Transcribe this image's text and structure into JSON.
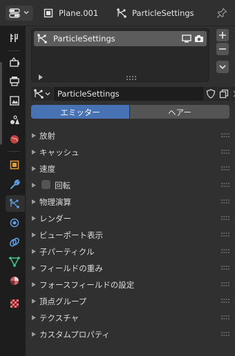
{
  "header": {
    "object_name": "Plane.001",
    "particle_settings_name": "ParticleSettings"
  },
  "list": {
    "items": [
      {
        "label": "ParticleSettings"
      }
    ]
  },
  "datablock": {
    "name": "ParticleSettings"
  },
  "type_toggle": {
    "emitter_label": "エミッター",
    "hair_label": "ヘアー",
    "selected": "エミッター"
  },
  "panels": [
    {
      "label": "放射"
    },
    {
      "label": "キャッシュ"
    },
    {
      "label": "速度"
    },
    {
      "label": "回転",
      "checkbox": false
    },
    {
      "label": "物理演算"
    },
    {
      "label": "レンダー"
    },
    {
      "label": "ビューポート表示"
    },
    {
      "label": "子パーティクル"
    },
    {
      "label": "フィールドの重み"
    },
    {
      "label": "フォースフィールドの設定"
    },
    {
      "label": "頂点グループ"
    },
    {
      "label": "テクスチャ"
    },
    {
      "label": "カスタムプロパティ"
    }
  ],
  "property_tabs": [
    {
      "icon": "tool-icon"
    },
    {
      "icon": "render-icon"
    },
    {
      "icon": "output-icon"
    },
    {
      "icon": "view-layer-icon"
    },
    {
      "icon": "scene-icon"
    },
    {
      "icon": "world-icon"
    },
    {
      "icon": "object-icon"
    },
    {
      "icon": "modifier-wrench-icon"
    },
    {
      "icon": "particles-icon",
      "active": true
    },
    {
      "icon": "physics-icon"
    },
    {
      "icon": "constraints-icon"
    },
    {
      "icon": "object-data-mesh-icon"
    },
    {
      "icon": "material-icon"
    },
    {
      "icon": "texture-icon"
    }
  ],
  "colors": {
    "accent": "#4772b3",
    "background": "#303030",
    "sidebar": "#1d1d1d"
  }
}
